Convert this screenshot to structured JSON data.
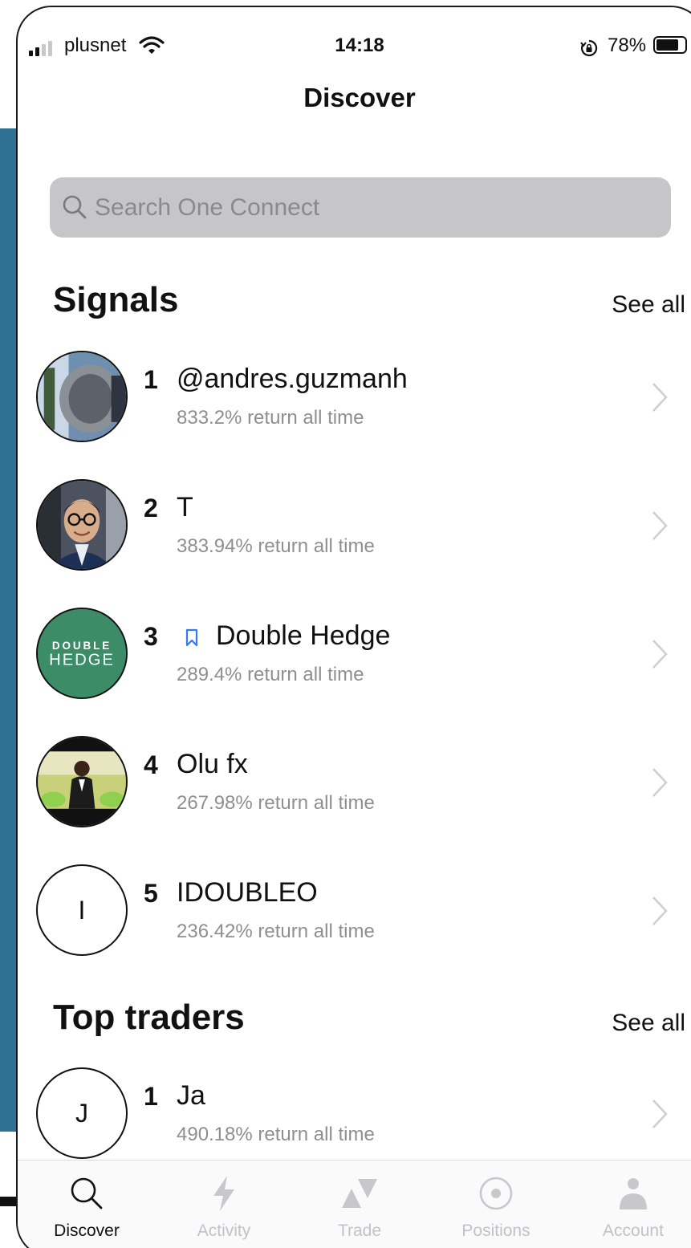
{
  "status_bar": {
    "carrier": "plusnet",
    "time": "14:18",
    "battery": "78%"
  },
  "nav": {
    "title": "Discover"
  },
  "search": {
    "placeholder": "Search One Connect"
  },
  "signals": {
    "title": "Signals",
    "see_all": "See all",
    "items": [
      {
        "rank": "1",
        "name": "@andres.guzmanh",
        "subtitle": "833.2% return all time"
      },
      {
        "rank": "2",
        "name": "T",
        "subtitle": "383.94% return all time"
      },
      {
        "rank": "3",
        "name": "Double Hedge",
        "subtitle": "289.4% return all time",
        "logo_line1": "DOUBLE",
        "logo_line2": "HEDGE"
      },
      {
        "rank": "4",
        "name": "Olu fx",
        "subtitle": "267.98% return all time"
      },
      {
        "rank": "5",
        "name": "IDOUBLEO",
        "subtitle": "236.42% return all time",
        "initial": "I"
      }
    ]
  },
  "top_traders": {
    "title": "Top traders",
    "see_all": "See all",
    "items": [
      {
        "rank": "1",
        "name": "Ja",
        "subtitle": "490.18% return all time",
        "initial": "J"
      }
    ]
  },
  "tabs": [
    {
      "label": "Discover",
      "icon": "search-icon",
      "active": true
    },
    {
      "label": "Activity",
      "icon": "bolt-icon",
      "active": false
    },
    {
      "label": "Trade",
      "icon": "trade-icon",
      "active": false
    },
    {
      "label": "Positions",
      "icon": "target-icon",
      "active": false
    },
    {
      "label": "Account",
      "icon": "person-icon",
      "active": false
    }
  ],
  "colors": {
    "accent": "#3478f6",
    "logo_green": "#3d8c68",
    "tab_inactive": "#c2c2c6",
    "side_panel": "#2f7093"
  }
}
